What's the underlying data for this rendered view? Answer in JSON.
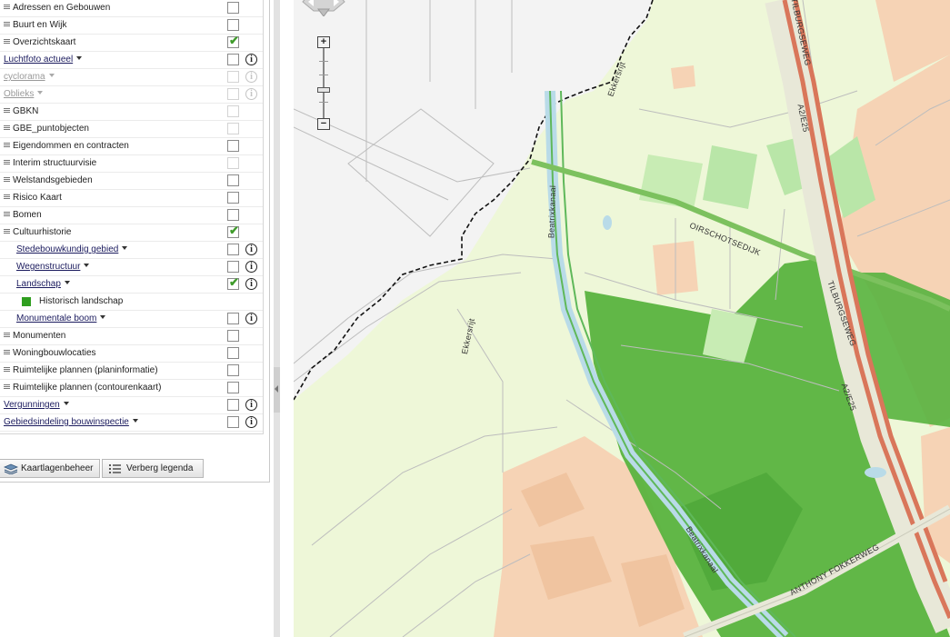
{
  "layers": [
    {
      "label": "Adressen en Gebouwen",
      "group": true,
      "checked": false
    },
    {
      "label": "Buurt en Wijk",
      "group": true,
      "checked": false
    },
    {
      "label": "Overzichtskaart",
      "group": true,
      "checked": true
    },
    {
      "label": "Luchtfoto actueel",
      "style": "link",
      "dropdown": true,
      "checked": false,
      "info": true
    },
    {
      "label": "cyclorama",
      "style": "dim",
      "dropdown": true,
      "checked": false,
      "disabled": true,
      "info": true,
      "info_dim": true
    },
    {
      "label": "Oblieks",
      "style": "dim",
      "dropdown": true,
      "checked": false,
      "disabled": true,
      "info": true,
      "info_dim": true
    },
    {
      "label": "GBKN",
      "group": true,
      "checked": false,
      "disabled": true
    },
    {
      "label": "GBE_puntobjecten",
      "group": true,
      "checked": false,
      "disabled": true
    },
    {
      "label": "Eigendommen en contracten",
      "group": true,
      "checked": false
    },
    {
      "label": "Interim structuurvisie",
      "group": true,
      "checked": false,
      "disabled": true
    },
    {
      "label": "Welstandsgebieden",
      "group": true,
      "checked": false
    },
    {
      "label": "Risico Kaart",
      "group": true,
      "checked": false
    },
    {
      "label": "Bomen",
      "group": true,
      "checked": false
    },
    {
      "label": "Cultuurhistorie",
      "group": true,
      "checked": true
    },
    {
      "label": "Stedebouwkundig gebied",
      "style": "link",
      "dropdown": true,
      "indent": true,
      "checked": false,
      "info": true
    },
    {
      "label": "Wegenstructuur",
      "style": "link",
      "dropdown": true,
      "indent": true,
      "checked": false,
      "info": true
    },
    {
      "label": "Landschap",
      "style": "link",
      "dropdown": true,
      "indent": true,
      "checked": true,
      "info": true
    },
    {
      "label": "Historisch landschap",
      "legend": true,
      "color": "#2f9e1f"
    },
    {
      "label": "Monumentale boom",
      "style": "link",
      "dropdown": true,
      "indent": true,
      "checked": false,
      "info": true
    },
    {
      "label": "Monumenten",
      "group": true,
      "checked": false
    },
    {
      "label": "Woningbouwlocaties",
      "group": true,
      "checked": false
    },
    {
      "label": "Ruimtelijke plannen (planinformatie)",
      "group": true,
      "checked": false
    },
    {
      "label": "Ruimtelijke plannen (contourenkaart)",
      "group": true,
      "checked": false
    },
    {
      "label": "Vergunningen",
      "style": "link",
      "dropdown": true,
      "checked": false,
      "info": true
    },
    {
      "label": "Gebiedsindeling bouwinspectie",
      "style": "link",
      "dropdown": true,
      "checked": false,
      "info": true
    }
  ],
  "buttons": {
    "layer_manager": "Kaartlagenbeheer",
    "hide_legend": "Verberg legenda"
  },
  "map": {
    "zoom_in": "+",
    "zoom_out": "−",
    "labels": {
      "tilburgseweg_1": "TILBURGSEWEG",
      "a2e25_1": "A2/E25",
      "tilburgseweg_2": "TILBURGSEWEG",
      "a2e25_2": "A2/E25",
      "oirschotsedijk": "OIRSCHOTSEDIJK",
      "beatrixkanaal_1": "Beatrixkanaal",
      "beatrixkanaal_2": "Beatrixkanaal",
      "ekkersrijt_1": "Ekkersrijt",
      "ekkersrijt_2": "Ekkersrijt",
      "anthony_fokkerweg": "ANTHONY FOKKERWEG"
    }
  },
  "colors": {
    "historisch_landschap": "#2f9e1f",
    "motorway": "#d9765a",
    "grass": "#eef7d8"
  }
}
